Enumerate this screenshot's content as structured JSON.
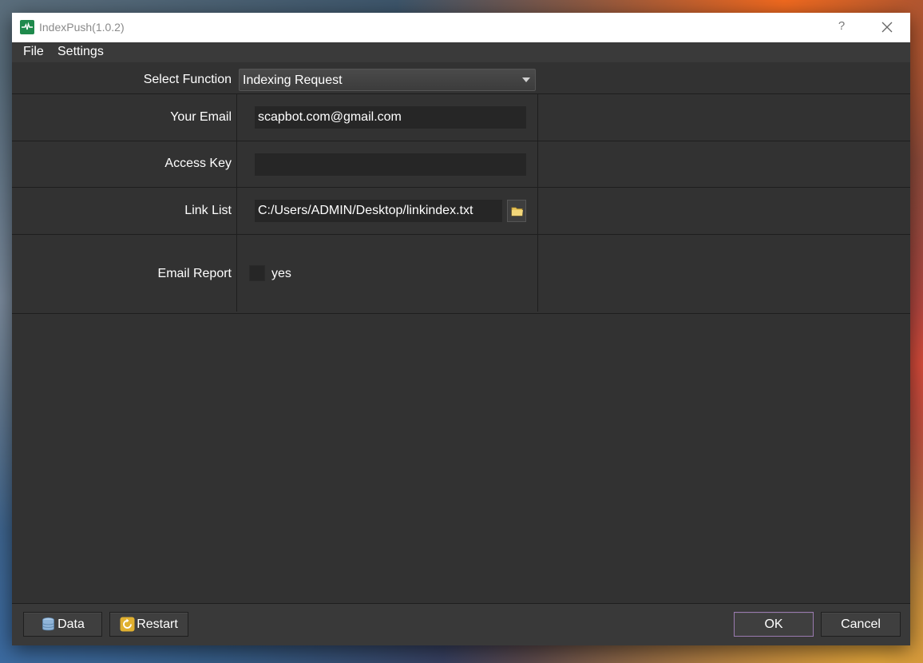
{
  "window": {
    "title": "IndexPush(1.0.2)",
    "help_label": "?"
  },
  "menu": {
    "items": [
      "File",
      "Settings"
    ]
  },
  "form": {
    "select_function": {
      "label": "Select Function",
      "value": "Indexing Request"
    },
    "email": {
      "label": "Your Email",
      "value": "scapbot.com@gmail.com"
    },
    "access_key": {
      "label": "Access Key",
      "value": ""
    },
    "link_list": {
      "label": "Link List",
      "value": "C:/Users/ADMIN/Desktop/linkindex.txt"
    },
    "email_report": {
      "label": "Email Report",
      "option_label": "yes",
      "checked": false
    }
  },
  "footer": {
    "data_label": "Data",
    "restart_label": "Restart",
    "ok_label": "OK",
    "cancel_label": "Cancel"
  },
  "colors": {
    "window_bg": "#323232",
    "titlebar_bg": "#ffffff",
    "app_icon": "#1f8a4c",
    "ok_border": "#9a7ab0",
    "folder_icon": "#e8c45a",
    "restart_icon": "#e0b030",
    "data_icon": "#8fb4d8"
  }
}
